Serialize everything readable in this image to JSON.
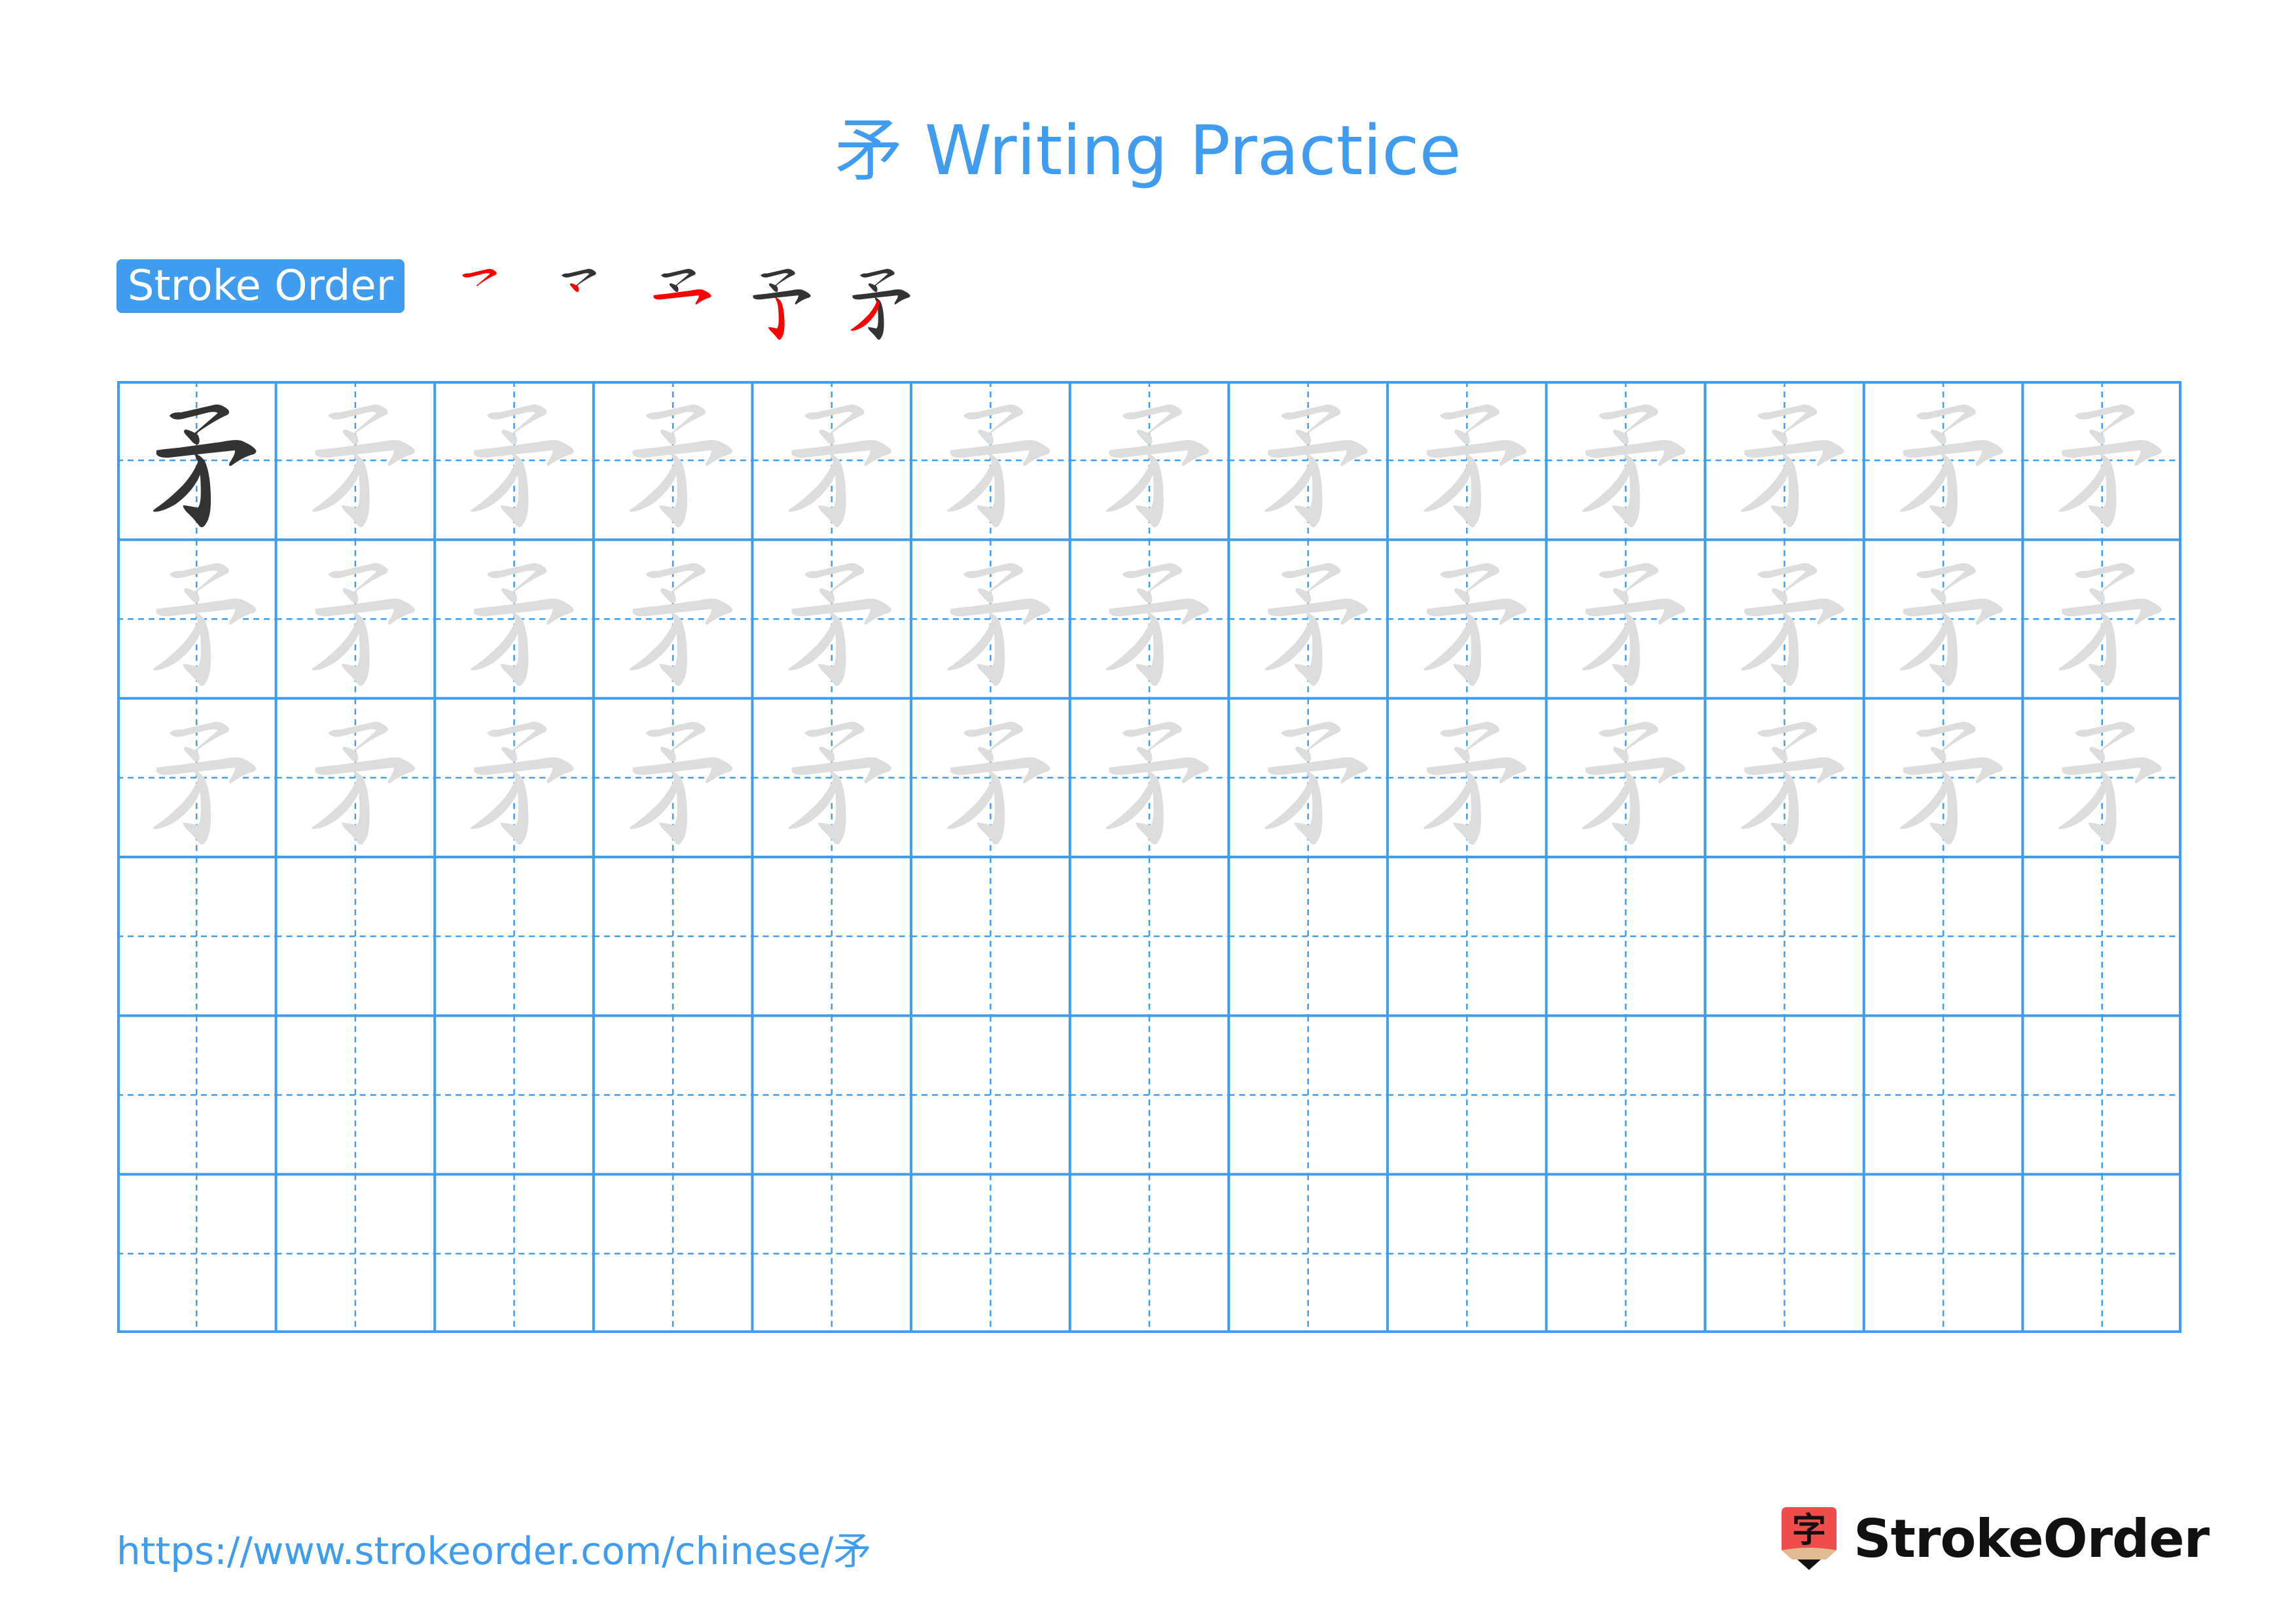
{
  "page": {
    "title": "矛 Writing Practice",
    "character": "矛"
  },
  "stroke_order": {
    "label": "Stroke Order",
    "steps": 5
  },
  "grid": {
    "columns": 13,
    "rows": 6,
    "model_cells": 1,
    "trace_rows": 3,
    "blank_rows": 3
  },
  "footer": {
    "url": "https://www.strokeorder.com/chinese/矛",
    "brand": "StrokeOrder",
    "logo_glyph": "字"
  },
  "colors": {
    "accent": "#3f9cef",
    "model_stroke": "#333333",
    "trace_stroke": "#dddddd",
    "highlight_stroke": "#ff0000",
    "logo_red": "#ef4c4c",
    "logo_tan": "#e0bc94"
  }
}
